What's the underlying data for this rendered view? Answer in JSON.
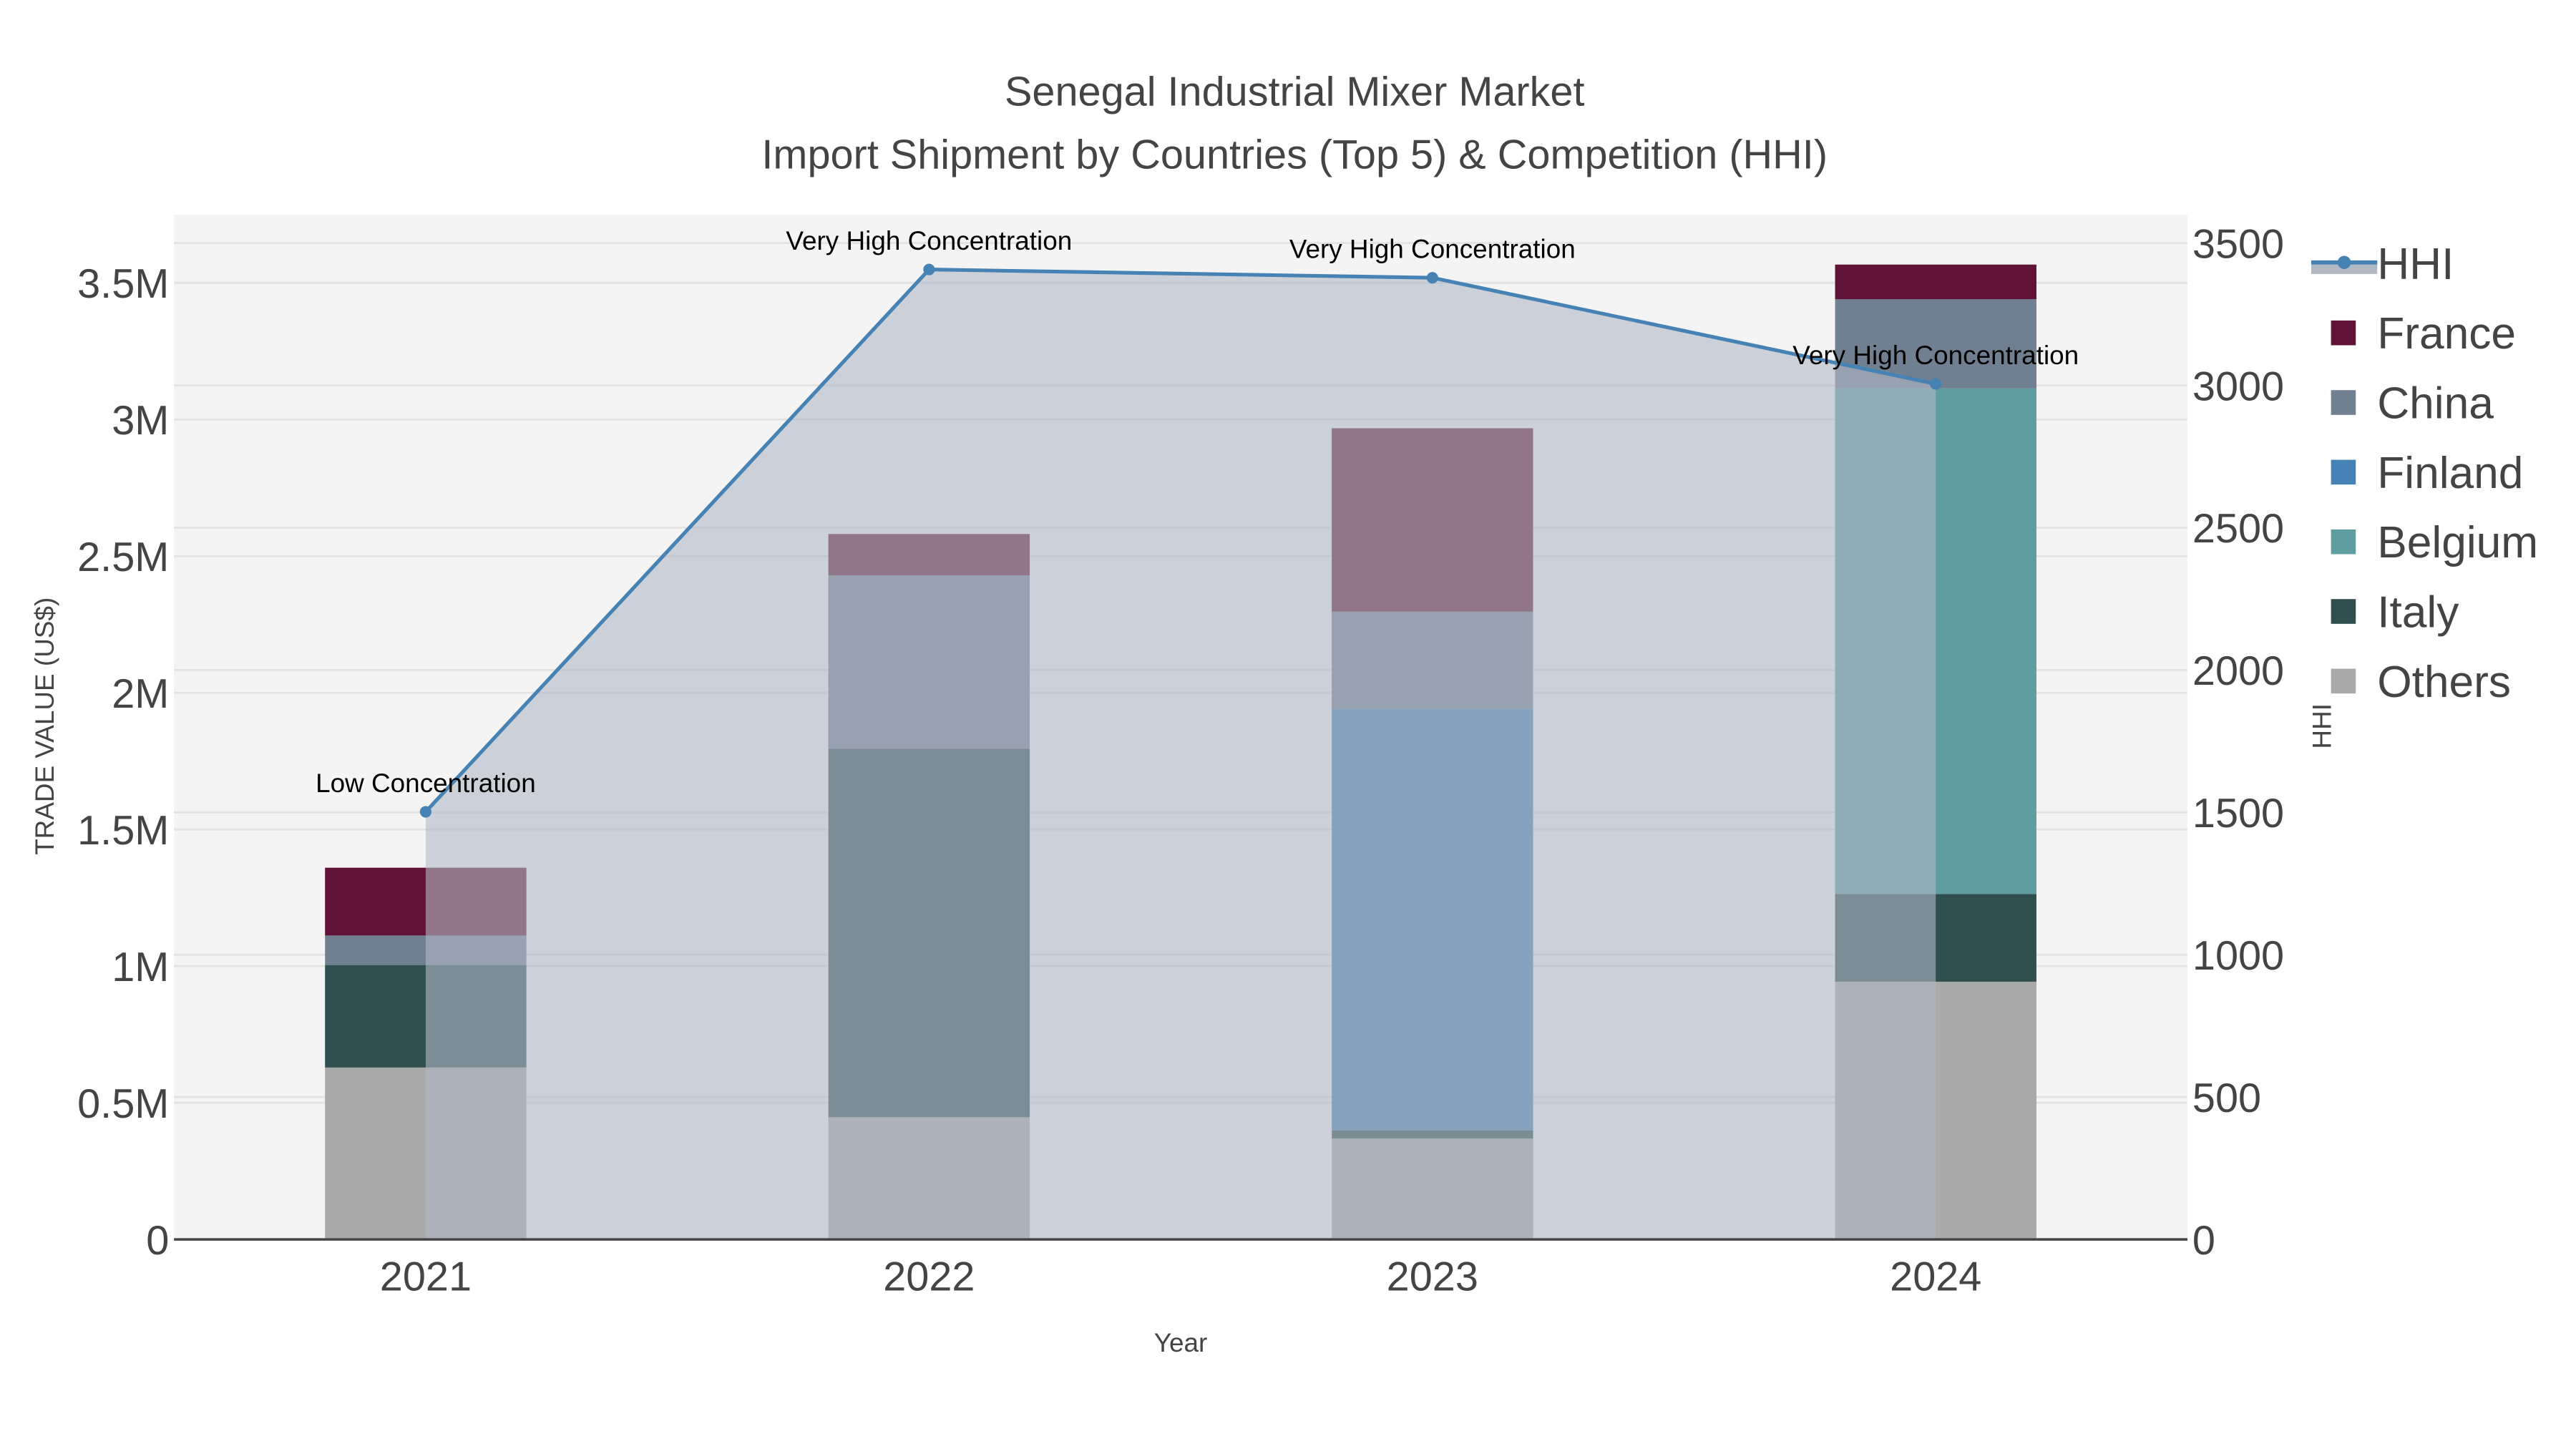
{
  "chart_data": {
    "type": "bar",
    "title_line1": "Senegal Industrial Mixer Market",
    "title_line2": "Import Shipment by Countries (Top 5) & Competition (HHI)",
    "xlabel": "Year",
    "ylabel": "TRADE VALUE (US$)",
    "y2label": "HHI",
    "categories": [
      "2021",
      "2022",
      "2023",
      "2024"
    ],
    "ylim": [
      0,
      3750000
    ],
    "y2lim": [
      0,
      3600
    ],
    "yticks": [
      0,
      500000,
      1000000,
      1500000,
      2000000,
      2500000,
      3000000,
      3500000
    ],
    "ytick_labels": [
      "0",
      "0.5M",
      "1M",
      "1.5M",
      "2M",
      "2.5M",
      "3M",
      "3.5M"
    ],
    "y2ticks": [
      0,
      500,
      1000,
      1500,
      2000,
      2500,
      3000,
      3500
    ],
    "y2tick_labels": [
      "0",
      "500",
      "1000",
      "1500",
      "2000",
      "2500",
      "3000",
      "3500"
    ],
    "barmode": "stack",
    "series": [
      {
        "name": "Others",
        "color": "#a9a9a9",
        "values": [
          629000,
          447000,
          369000,
          943000
        ]
      },
      {
        "name": "Italy",
        "color": "#2f4f4f",
        "values": [
          375000,
          1349000,
          30000,
          321000
        ]
      },
      {
        "name": "Belgium",
        "color": "#5f9ea0",
        "values": [
          0,
          0,
          0,
          1850000
        ]
      },
      {
        "name": "Finland",
        "color": "#4682b4",
        "values": [
          0,
          0,
          1542000,
          0
        ]
      },
      {
        "name": "China",
        "color": "#708090",
        "values": [
          108000,
          634000,
          356000,
          326000
        ]
      },
      {
        "name": "France",
        "color": "#601236",
        "values": [
          248000,
          151000,
          671000,
          127000
        ]
      }
    ],
    "line": {
      "name": "HHI",
      "color": "#4682b4",
      "fill": "#b0b8c4",
      "values": [
        1502,
        3407,
        3378,
        3005
      ],
      "annotations": [
        "Low Concentration",
        "Very High Concentration",
        "Very High Concentration",
        "Very High Concentration"
      ]
    },
    "legend": {
      "placement": "right",
      "order": [
        "HHI",
        "France",
        "China",
        "Finland",
        "Belgium",
        "Italy",
        "Others"
      ]
    },
    "grid": true
  }
}
